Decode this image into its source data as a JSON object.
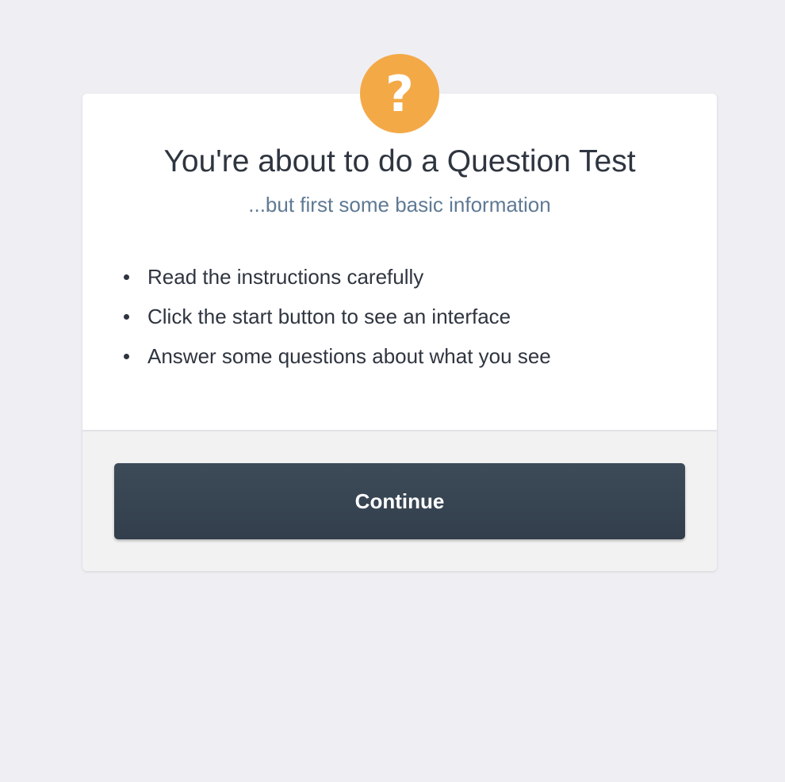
{
  "badge": {
    "icon": "question-mark-icon",
    "glyph": "?",
    "color": "#f4a947"
  },
  "header": {
    "title": "You're about to do a Question Test",
    "subtitle": "...but first some basic information"
  },
  "instructions": [
    "Read the instructions carefully",
    "Click the start button to see an interface",
    "Answer some questions about what you see"
  ],
  "footer": {
    "continue_label": "Continue"
  },
  "colors": {
    "background": "#efeff3",
    "accent": "#f4a947",
    "subtitle": "#5f7a94",
    "button": "#3a4756"
  }
}
